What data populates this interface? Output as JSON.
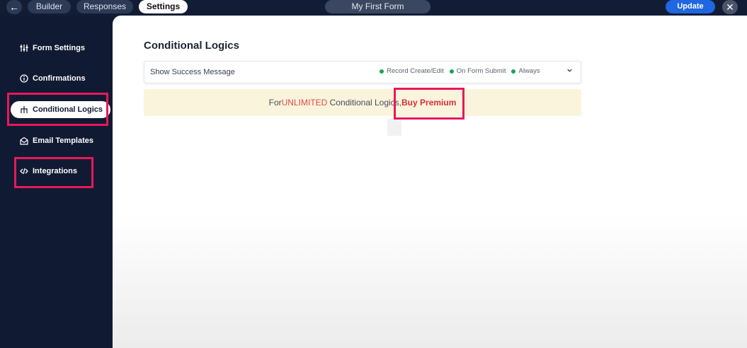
{
  "topbar": {
    "back_icon": "arrow-left-icon",
    "tabs": [
      {
        "label": "Builder"
      },
      {
        "label": "Responses"
      },
      {
        "label": "Settings",
        "active": true
      }
    ],
    "form_title": "My First Form",
    "update_label": "Update",
    "close_icon": "close-icon"
  },
  "sidebar": {
    "items": [
      {
        "label": "Form Settings",
        "icon": "sliders-icon"
      },
      {
        "label": "Confirmations",
        "icon": "info-circle-icon"
      },
      {
        "label": "Conditional Logics",
        "icon": "branch-icon",
        "active": true
      },
      {
        "label": "Email Templates",
        "icon": "envelope-icon"
      },
      {
        "label": "Integrations",
        "icon": "code-icon"
      }
    ]
  },
  "main": {
    "title": "Conditional Logics",
    "select": {
      "label": "Show Success Message",
      "tags": [
        "Record Create/Edit",
        "On Form Submit",
        "Always"
      ],
      "tag_color": "#1aa35a"
    },
    "banner": {
      "prefix": "For",
      "highlight": "UNLIMITED",
      "middle": " Conditional Logics,",
      "cta": "Buy Premium"
    }
  },
  "colors": {
    "accent": "#1f67e0",
    "highlight_border": "#e8185a",
    "sidebar_bg": "#101b33",
    "banner_bg": "#fbf4dc"
  }
}
